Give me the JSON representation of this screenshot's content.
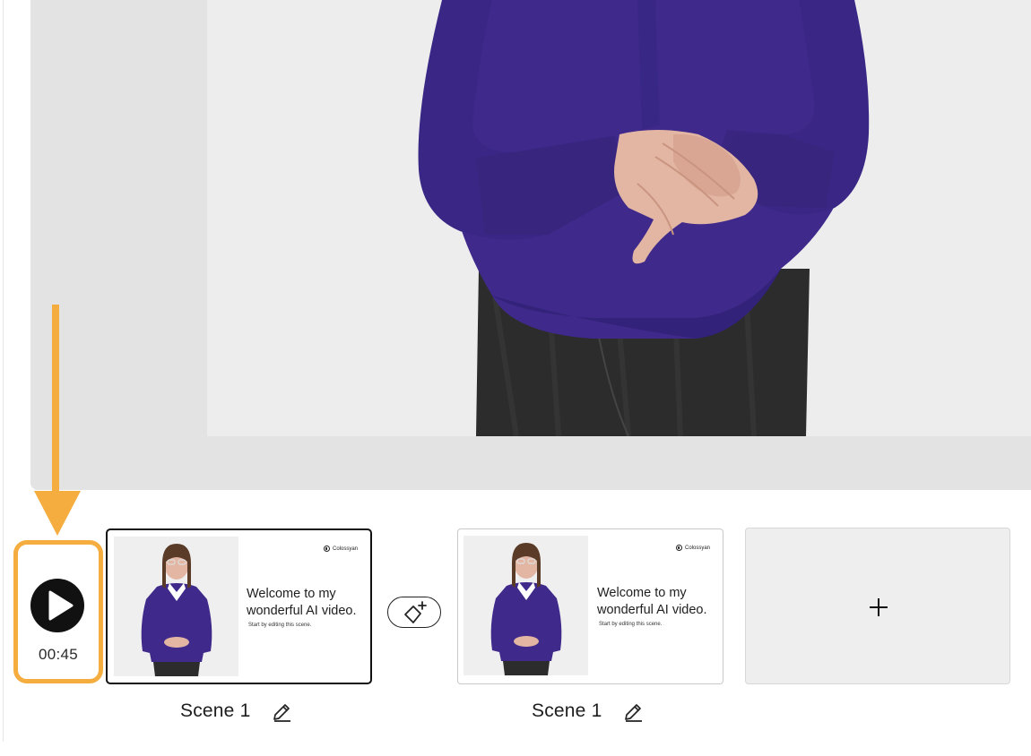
{
  "player": {
    "duration": "00:45"
  },
  "scenes": [
    {
      "label": "Scene 1",
      "brand": "Colossyan",
      "title": "Welcome to my wonderful AI video.",
      "subtitle": "Start by editing this scene.",
      "selected": true
    },
    {
      "label": "Scene 1",
      "brand": "Colossyan",
      "title": "Welcome to my wonderful AI video.",
      "subtitle": "Start by editing this scene.",
      "selected": false
    }
  ],
  "icons": {
    "play": "play-icon",
    "edit": "pencil-icon",
    "transition": "diamond-sparkle-icon",
    "add": "plus-icon",
    "callout": "down-arrow-callout"
  },
  "colors": {
    "highlight": "#f5ad3f",
    "sweater": "#3f2a8c",
    "canvas_bg": "#ededed",
    "canvas_frame": "#e3e3e3"
  }
}
